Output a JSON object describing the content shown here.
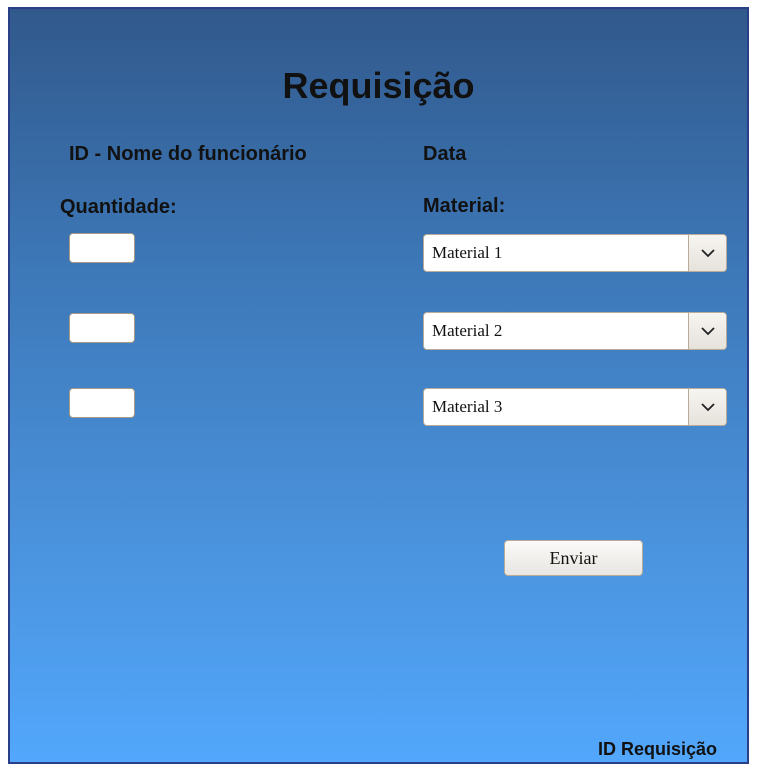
{
  "form": {
    "title": "Requisição",
    "employee_label": "ID - Nome do funcionário",
    "date_label": "Data",
    "quantity_label": "Quantidade:",
    "material_label": "Material:",
    "rows": [
      {
        "quantity": "",
        "material": "Material 1"
      },
      {
        "quantity": "",
        "material": "Material 2"
      },
      {
        "quantity": "",
        "material": "Material 3"
      }
    ],
    "submit_label": "Enviar",
    "requisition_id_label": "ID Requisição"
  },
  "icons": {
    "dropdown": "chevron-down-icon"
  },
  "colors": {
    "gradient_top": "#31598c",
    "gradient_bottom": "#52a7fc",
    "frame_border": "#2a3f88"
  }
}
